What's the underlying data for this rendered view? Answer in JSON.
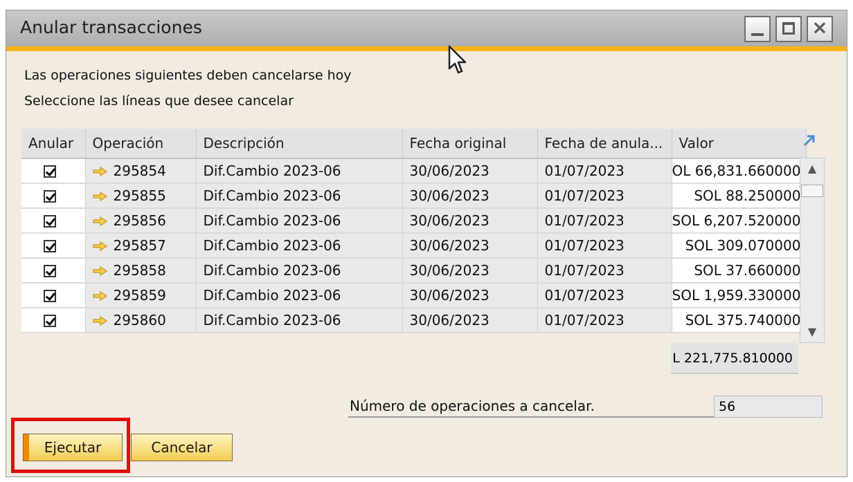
{
  "window": {
    "title": "Anular transacciones",
    "controls": [
      "minimize-icon",
      "maximize-icon",
      "close-icon"
    ],
    "close_glyph": "×"
  },
  "messages": {
    "line1": "Las operaciones siguientes deben cancelarse hoy",
    "line2": "Seleccione las líneas que desee cancelar"
  },
  "table": {
    "columns": [
      "Anular",
      "Operación",
      "Descripción",
      "Fecha original",
      "Fecha de anula...",
      "Valor"
    ],
    "rows": [
      {
        "checked": true,
        "operacion": "295854",
        "descripcion": "Dif.Cambio 2023-06",
        "fecha_original": "30/06/2023",
        "fecha_anulacion": "01/07/2023",
        "valor": "OL 66,831.660000"
      },
      {
        "checked": true,
        "operacion": "295855",
        "descripcion": "Dif.Cambio 2023-06",
        "fecha_original": "30/06/2023",
        "fecha_anulacion": "01/07/2023",
        "valor": "SOL 88.250000"
      },
      {
        "checked": true,
        "operacion": "295856",
        "descripcion": "Dif.Cambio 2023-06",
        "fecha_original": "30/06/2023",
        "fecha_anulacion": "01/07/2023",
        "valor": "SOL 6,207.520000"
      },
      {
        "checked": true,
        "operacion": "295857",
        "descripcion": "Dif.Cambio 2023-06",
        "fecha_original": "30/06/2023",
        "fecha_anulacion": "01/07/2023",
        "valor": "SOL 309.070000"
      },
      {
        "checked": true,
        "operacion": "295858",
        "descripcion": "Dif.Cambio 2023-06",
        "fecha_original": "30/06/2023",
        "fecha_anulacion": "01/07/2023",
        "valor": "SOL 37.660000"
      },
      {
        "checked": true,
        "operacion": "295859",
        "descripcion": "Dif.Cambio 2023-06",
        "fecha_original": "30/06/2023",
        "fecha_anulacion": "01/07/2023",
        "valor": "SOL 1,959.330000"
      },
      {
        "checked": true,
        "operacion": "295860",
        "descripcion": "Dif.Cambio 2023-06",
        "fecha_original": "30/06/2023",
        "fecha_anulacion": "01/07/2023",
        "valor": "SOL 375.740000"
      }
    ],
    "total": "L 221,775.810000"
  },
  "count": {
    "label": "Número de operaciones a cancelar.",
    "value": "56"
  },
  "buttons": {
    "execute": "Ejecutar",
    "cancel": "Cancelar"
  },
  "colors": {
    "accent": "#f5b416",
    "highlight": "#e00d0d",
    "button": "#f2cd52"
  }
}
